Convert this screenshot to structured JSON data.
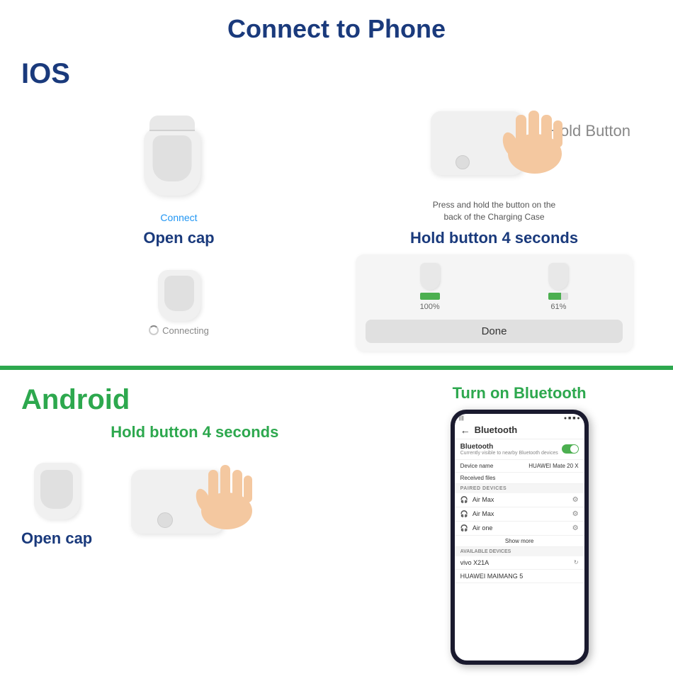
{
  "page": {
    "title": "Connect to Phone"
  },
  "ios": {
    "label": "IOS",
    "hold_button": "Hold Button",
    "step1_label": "Connect",
    "step1_title": "Open cap",
    "step2_desc1": "Press and hold the button on the",
    "step2_desc2": "back of the Charging Case",
    "step2_title": "Hold button 4 seconds",
    "connecting_label": "Connecting",
    "battery_100": "100%",
    "battery_61": "61%",
    "done_button": "Done"
  },
  "android": {
    "label": "Android",
    "turn_on_bt": "Turn on Bluetooth",
    "hold_button_title": "Hold button 4 seconds",
    "open_cap": "Open cap",
    "phone": {
      "title": "Bluetooth",
      "bt_main": "Bluetooth",
      "bt_sub": "Currently visible to nearby Bluetooth devices",
      "device_name_label": "Device name",
      "device_name_val": "HUAWEI Mate 20 X",
      "received_files": "Received files",
      "paired_header": "PAIRED DEVICES",
      "paired_devices": [
        "Air Max",
        "Air Max",
        "Air one"
      ],
      "show_more": "Show more",
      "available_header": "AVAILABLE DEVICES",
      "available_devices": [
        "vivo X21A",
        "HUAWEI MAIMANG 5"
      ]
    }
  }
}
